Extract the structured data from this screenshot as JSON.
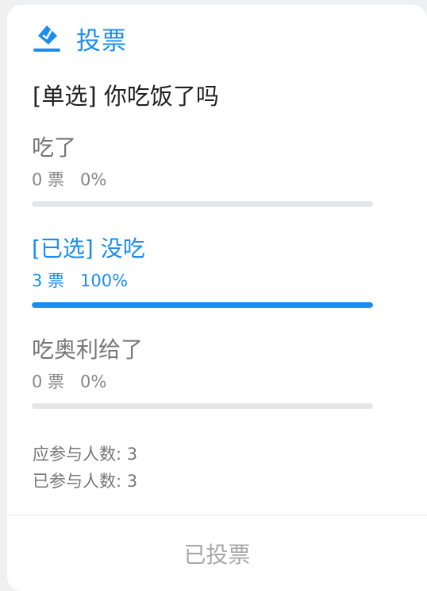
{
  "header": {
    "icon": "vote-icon",
    "title": "投票"
  },
  "question": "[单选] 你吃饭了吗",
  "options": [
    {
      "label": "吃了",
      "votes_text": "0 票",
      "percent_text": "0%",
      "percent": 0,
      "selected": false
    },
    {
      "label": "[已选] 没吃",
      "votes_text": "3 票",
      "percent_text": "100%",
      "percent": 100,
      "selected": true
    },
    {
      "label": "吃奥利给了",
      "votes_text": "0 票",
      "percent_text": "0%",
      "percent": 0,
      "selected": false
    }
  ],
  "summary": {
    "expected_participants": "应参与人数: 3",
    "actual_participants": "已参与人数: 3"
  },
  "footer": {
    "status_button": "已投票"
  },
  "colors": {
    "accent": "#1a8ef0",
    "muted_text": "#777777",
    "track": "#e5e6e7"
  }
}
